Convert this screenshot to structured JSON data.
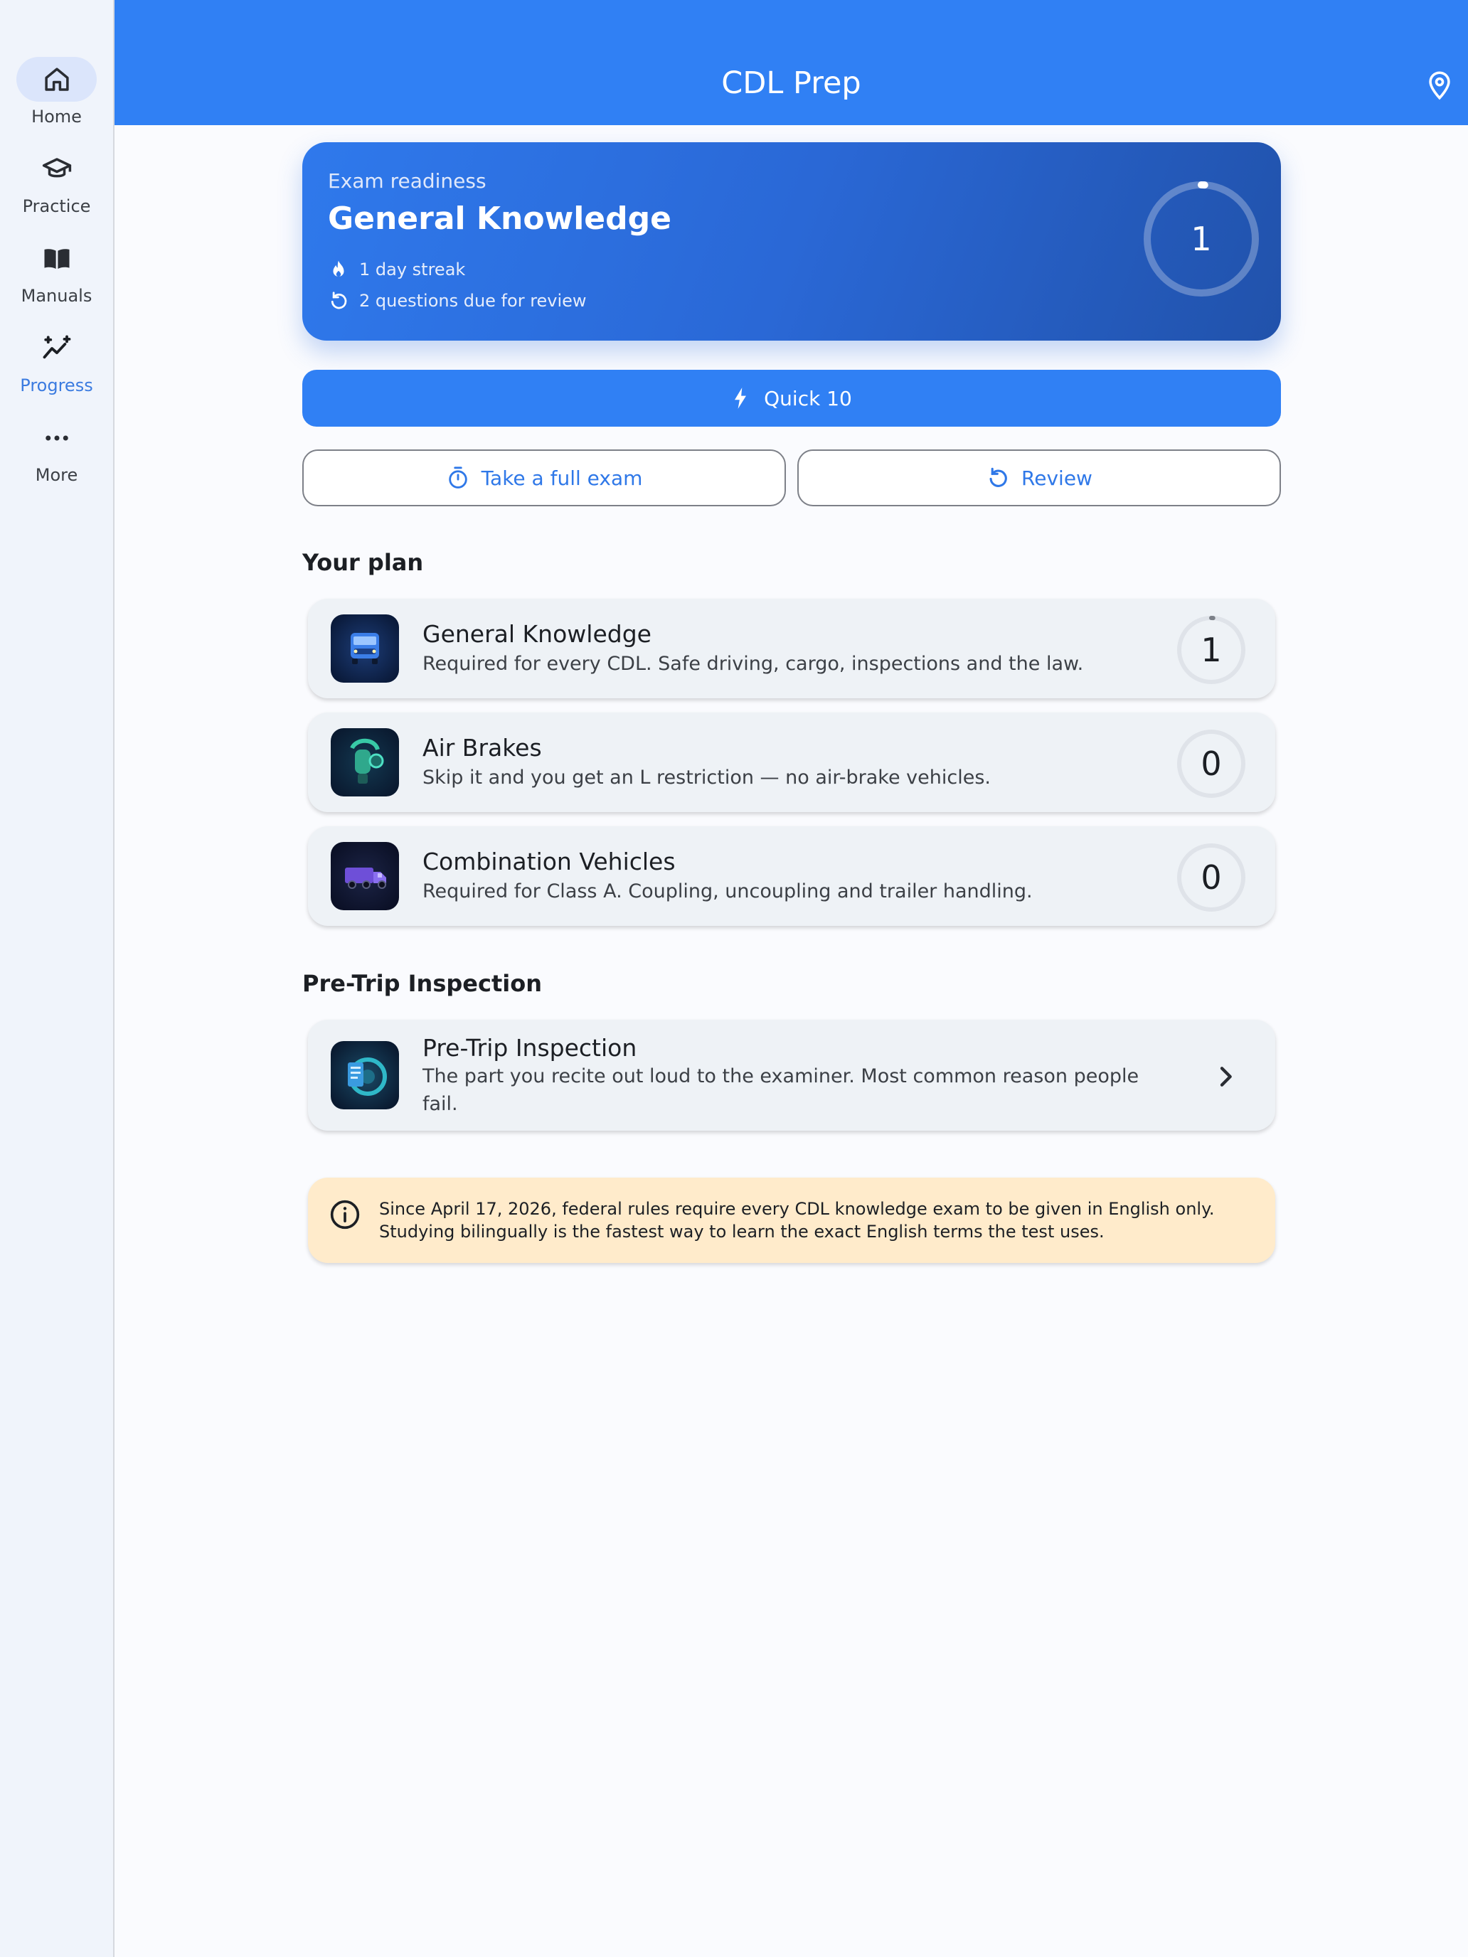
{
  "app": {
    "title": "CDL Prep"
  },
  "sidebar": {
    "items": [
      {
        "label": "Home",
        "icon": "home-icon",
        "active": true
      },
      {
        "label": "Practice",
        "icon": "graduation-cap-icon"
      },
      {
        "label": "Manuals",
        "icon": "book-icon"
      },
      {
        "label": "Progress",
        "icon": "trending-sparkle-icon",
        "accent": true
      },
      {
        "label": "More",
        "icon": "more-horizontal-icon"
      }
    ]
  },
  "header": {
    "location_icon": "location-pin-icon"
  },
  "readiness": {
    "kicker": "Exam readiness",
    "title": "General Knowledge",
    "streak": "1 day streak",
    "review_due": "2 questions due for review",
    "score": "1",
    "progress_fraction": 0.01
  },
  "actions": {
    "quick": "Quick 10",
    "full_exam": "Take a full exam",
    "review": "Review"
  },
  "plan": {
    "heading": "Your plan",
    "items": [
      {
        "title": "General Knowledge",
        "desc": "Required for every CDL. Safe driving, cargo, inspections and the law.",
        "score": "1",
        "progress_fraction": 0.01,
        "icon": "truck-front-icon"
      },
      {
        "title": "Air Brakes",
        "desc": "Skip it and you get an L restriction — no air-brake vehicles.",
        "score": "0",
        "progress_fraction": 0,
        "icon": "air-brake-icon"
      },
      {
        "title": "Combination Vehicles",
        "desc": "Required for Class A. Coupling, uncoupling and trailer handling.",
        "score": "0",
        "progress_fraction": 0,
        "icon": "tractor-trailer-icon"
      }
    ]
  },
  "pretrip": {
    "heading": "Pre-Trip Inspection",
    "title": "Pre-Trip Inspection",
    "desc": "The part you recite out loud to the examiner. Most common reason people fail.",
    "icon": "inspection-clipboard-icon"
  },
  "notice": {
    "text": "Since April 17, 2026, federal rules require every CDL knowledge exam to be given in English only. Studying bilingually is the fastest way to learn the exact English terms the test uses."
  },
  "colors": {
    "primary": "#3080f4",
    "hero_dark": "#2152ab",
    "notice_bg": "#ffebcb",
    "card_bg": "#eef2f6",
    "sidebar_bg": "#f0f4fb",
    "accent_text": "#2f78e8"
  }
}
